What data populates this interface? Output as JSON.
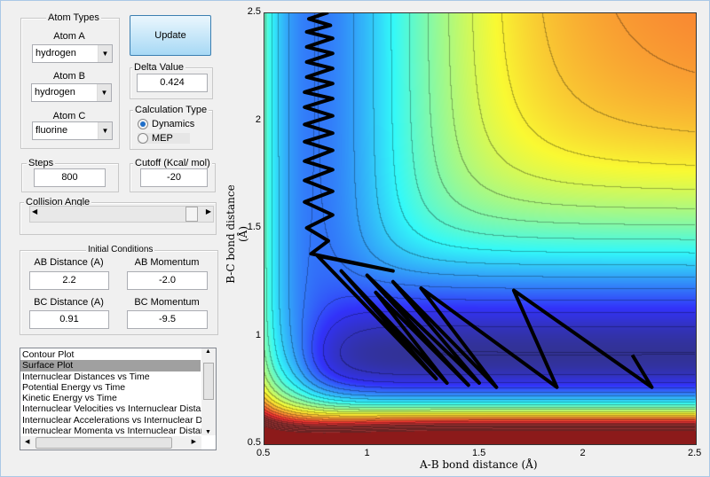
{
  "atom_types": {
    "title": "Atom Types",
    "atom_a_label": "Atom A",
    "atom_a": "hydrogen",
    "atom_b_label": "Atom B",
    "atom_b": "hydrogen",
    "atom_c_label": "Atom C",
    "atom_c": "fluorine"
  },
  "update_label": "Update",
  "delta": {
    "title": "Delta Value",
    "value": "0.424"
  },
  "calc_type": {
    "title": "Calculation Type",
    "options": [
      "Dynamics",
      "MEP"
    ],
    "selected": "Dynamics"
  },
  "steps": {
    "title": "Steps",
    "value": "800"
  },
  "cutoff": {
    "title": "Cutoff (Kcal/ mol)",
    "value": "-20"
  },
  "collision": {
    "title": "Collision Angle",
    "slider_fraction": 1.0
  },
  "initial": {
    "title": "Initial Conditions",
    "ab_dist_label": "AB Distance (A)",
    "ab_dist": "2.2",
    "ab_mom_label": "AB Momentum",
    "ab_mom": "-2.0",
    "bc_dist_label": "BC Distance (A)",
    "bc_dist": "0.91",
    "bc_mom_label": "BC Momentum",
    "bc_mom": "-9.5"
  },
  "plot_list": {
    "items": [
      "Contour Plot",
      "Surface Plot",
      "Internuclear Distances vs Time",
      "Potential Energy vs Time",
      "Kinetic Energy vs Time",
      "Internuclear Velocities vs Internuclear Distance",
      "Internuclear Accelerations vs Internuclear Distance",
      "Internuclear Momenta vs Internuclear Distance"
    ],
    "selected": "Surface Plot"
  },
  "chart_data": {
    "type": "heatmap",
    "xlabel": "A-B bond distance (Å)",
    "ylabel": "B-C bond distance (Å)",
    "xlim": [
      0.5,
      2.5
    ],
    "ylim": [
      0.5,
      2.5
    ],
    "xticks": [
      "0.5",
      "1",
      "1.5",
      "2",
      "2.5"
    ],
    "yticks": [
      "0.5",
      "1",
      "1.5",
      "2",
      "2.5"
    ],
    "colormap": "jet",
    "trajectory_color": "#000000",
    "trajectory": [
      [
        2.21,
        0.91
      ],
      [
        2.3,
        0.76
      ],
      [
        1.66,
        1.21
      ],
      [
        1.86,
        0.76
      ],
      [
        1.23,
        1.22
      ],
      [
        1.58,
        0.76
      ],
      [
        1.1,
        1.25
      ],
      [
        1.5,
        0.78
      ],
      [
        0.98,
        1.28
      ],
      [
        1.45,
        0.77
      ],
      [
        1.02,
        1.2
      ],
      [
        1.35,
        0.78
      ],
      [
        0.86,
        1.3
      ],
      [
        1.3,
        0.8
      ],
      [
        0.75,
        1.37
      ],
      [
        1.1,
        1.3
      ],
      [
        0.72,
        1.38
      ],
      [
        0.8,
        1.44
      ],
      [
        0.7,
        1.5
      ],
      [
        0.82,
        1.56
      ],
      [
        0.69,
        1.62
      ],
      [
        0.82,
        1.67
      ],
      [
        0.69,
        1.72
      ],
      [
        0.82,
        1.77
      ],
      [
        0.69,
        1.81
      ],
      [
        0.82,
        1.86
      ],
      [
        0.69,
        1.9
      ],
      [
        0.82,
        1.94
      ],
      [
        0.69,
        1.98
      ],
      [
        0.82,
        2.02
      ],
      [
        0.69,
        2.06
      ],
      [
        0.82,
        2.1
      ],
      [
        0.69,
        2.13
      ],
      [
        0.82,
        2.17
      ],
      [
        0.7,
        2.2
      ],
      [
        0.82,
        2.24
      ],
      [
        0.7,
        2.27
      ],
      [
        0.82,
        2.31
      ],
      [
        0.7,
        2.34
      ],
      [
        0.82,
        2.38
      ],
      [
        0.7,
        2.41
      ],
      [
        0.81,
        2.44
      ],
      [
        0.71,
        2.47
      ],
      [
        0.8,
        2.5
      ]
    ]
  }
}
